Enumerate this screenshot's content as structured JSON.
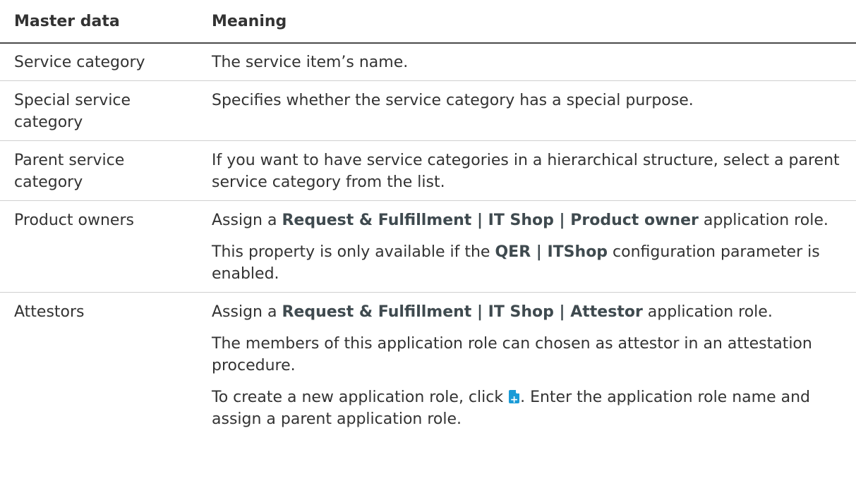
{
  "table": {
    "headers": {
      "col1": "Master data",
      "col2": "Meaning"
    },
    "rows": [
      {
        "name": "Service category",
        "p1": "The service item’s name."
      },
      {
        "name": "Special service category",
        "p1": "Specifies whether the service category has a special purpose."
      },
      {
        "name": "Parent service category",
        "p1": "If you want to have service categories in a hierarchical structure, select a parent service category from the list."
      },
      {
        "name": "Product owners",
        "p1_pre": "Assign a ",
        "p1_bold": "Request & Fulfillment | IT Shop | Product owner",
        "p1_post": " application role.",
        "p2_pre": "This property is only available if the ",
        "p2_bold": "QER | ITShop",
        "p2_post": " configuration parameter is enabled."
      },
      {
        "name": "Attestors",
        "p1_pre": "Assign a ",
        "p1_bold": "Request & Fulfillment | IT Shop | Attestor",
        "p1_post": " application role.",
        "p2": "The members of this application role can chosen as attestor in an attestation procedure.",
        "p3_pre": "To create a new application role, click ",
        "p3_icon": "add-application-role-icon",
        "p3_post": ". Enter the application role name and assign a parent application role."
      }
    ]
  },
  "colors": {
    "text": "#333333",
    "bold_text": "#3f4a4f",
    "icon": "#1a9bd7",
    "rule": "#cfcfcf"
  }
}
